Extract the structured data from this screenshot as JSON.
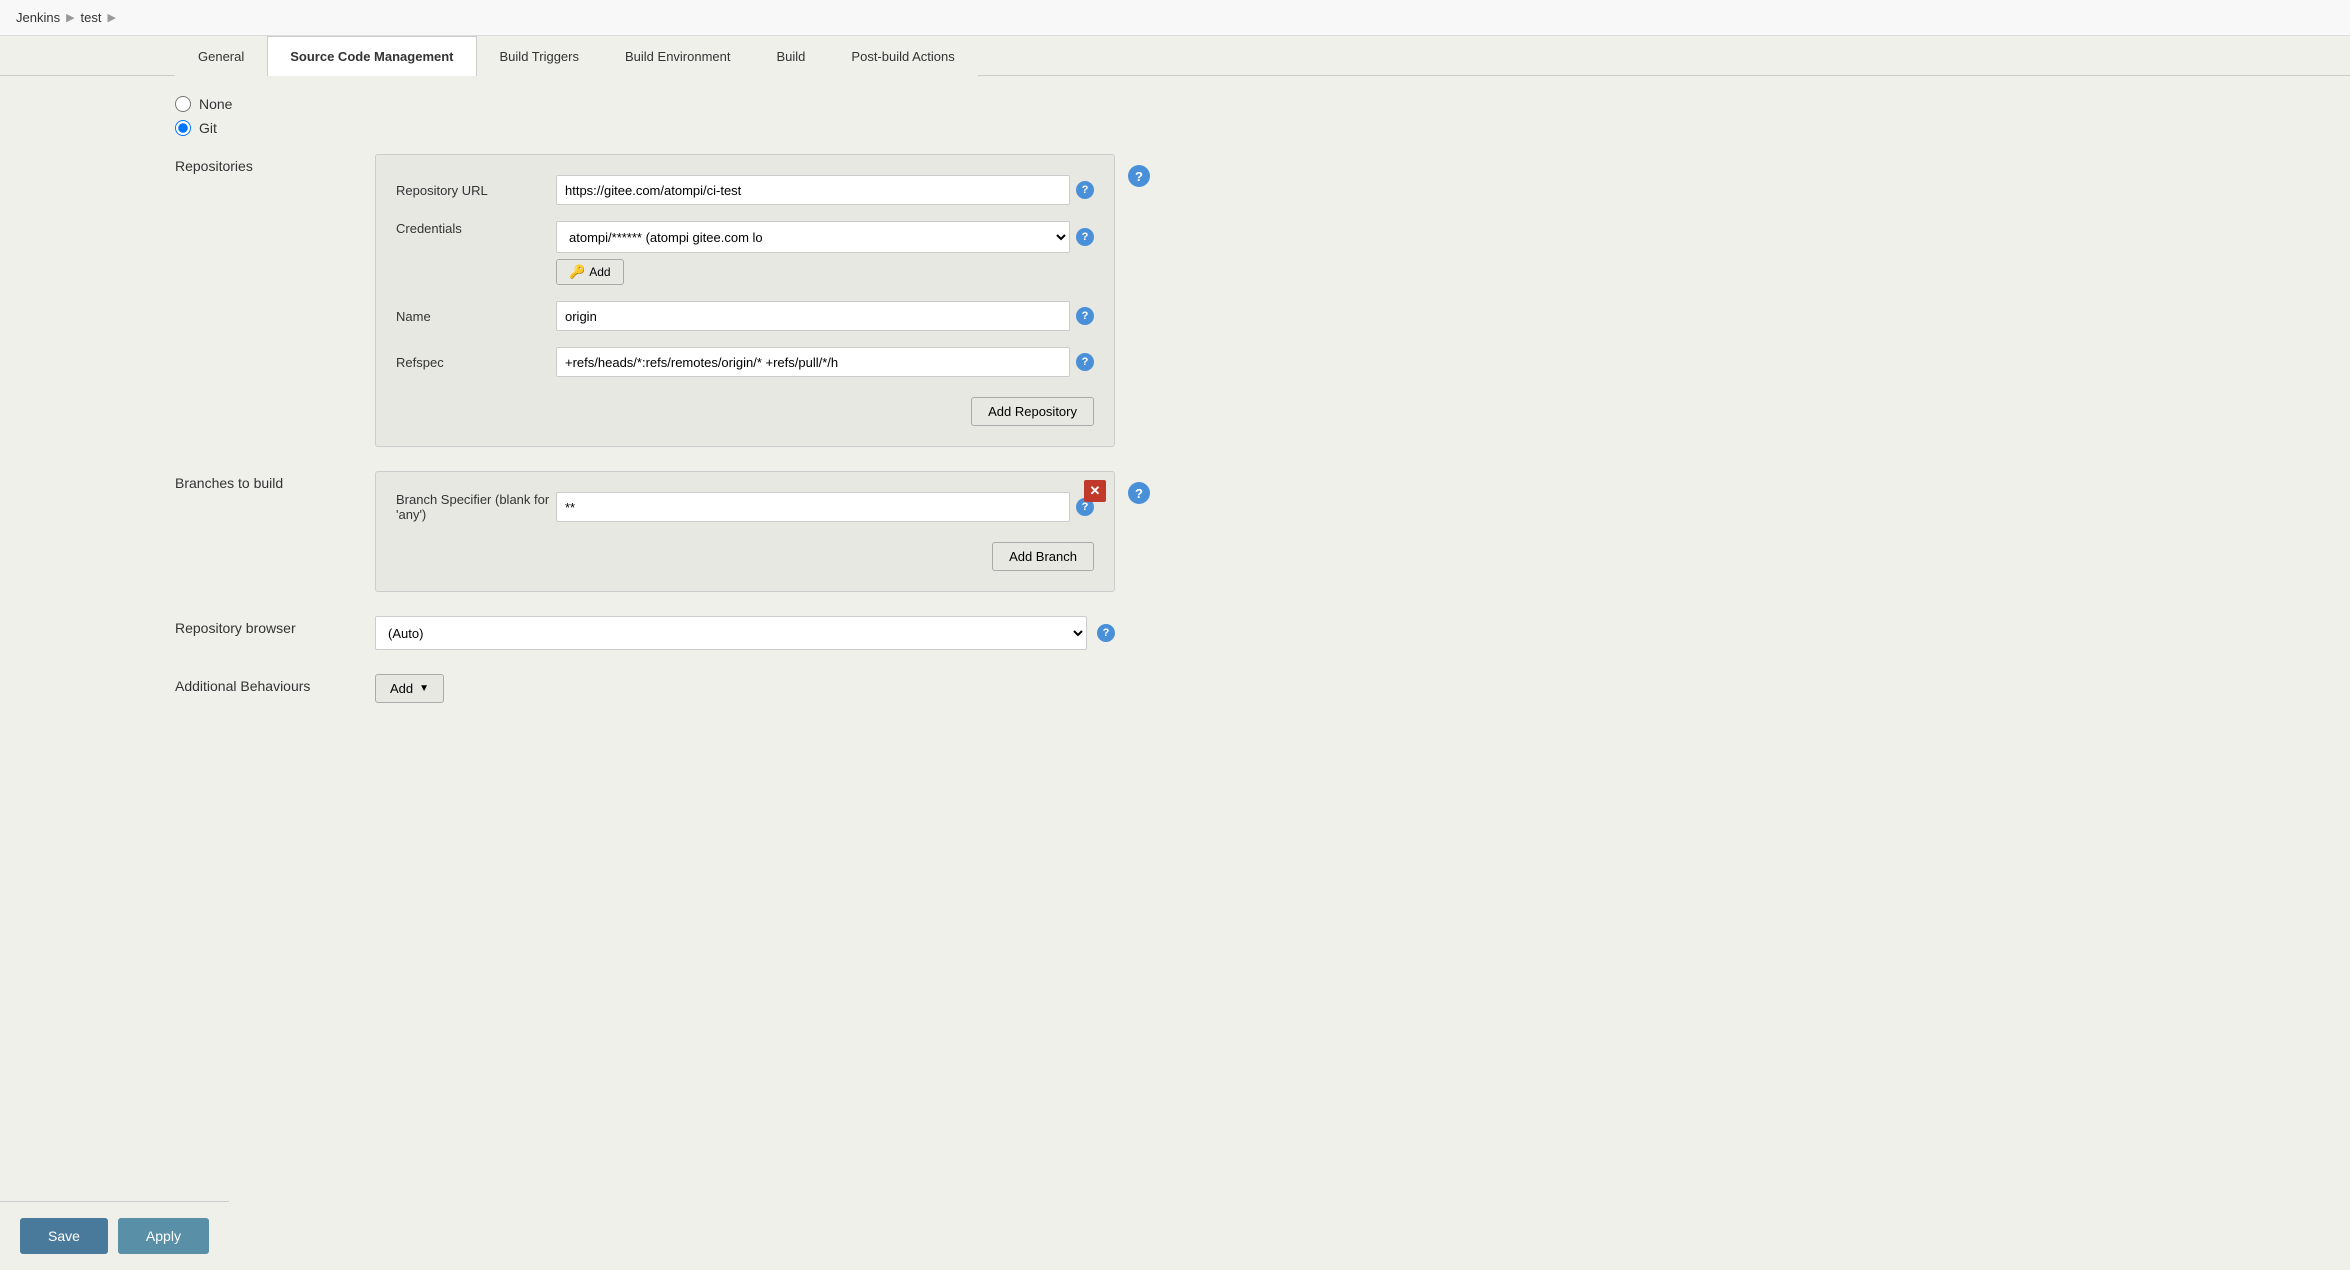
{
  "breadcrumb": {
    "items": [
      "Jenkins",
      "test"
    ],
    "separators": [
      "▶",
      "▶"
    ]
  },
  "tabs": [
    {
      "id": "general",
      "label": "General",
      "active": false
    },
    {
      "id": "source-code-management",
      "label": "Source Code Management",
      "active": true
    },
    {
      "id": "build-triggers",
      "label": "Build Triggers",
      "active": false
    },
    {
      "id": "build-environment",
      "label": "Build Environment",
      "active": false
    },
    {
      "id": "build",
      "label": "Build",
      "active": false
    },
    {
      "id": "post-build-actions",
      "label": "Post-build Actions",
      "active": false
    }
  ],
  "scm": {
    "options": [
      {
        "id": "none",
        "label": "None",
        "selected": false
      },
      {
        "id": "git",
        "label": "Git",
        "selected": true
      }
    ],
    "repositories_label": "Repositories",
    "repository_url_label": "Repository URL",
    "repository_url_value": "https://gitee.com/atompi/ci-test",
    "credentials_label": "Credentials",
    "credentials_value": "atompi/****** (atompi gitee.com lo",
    "name_label": "Name",
    "name_value": "origin",
    "refspec_label": "Refspec",
    "refspec_value": "+refs/heads/*:refs/remotes/origin/* +refs/pull/*/h",
    "add_repository_label": "Add Repository",
    "add_credentials_label": "Add",
    "branches_label": "Branches to build",
    "branch_specifier_label": "Branch Specifier (blank for 'any')",
    "branch_specifier_value": "**",
    "add_branch_label": "Add Branch",
    "repo_browser_label": "Repository browser",
    "repo_browser_value": "(Auto)",
    "additional_behaviours_label": "Additional Behaviours",
    "add_label": "Add"
  },
  "buttons": {
    "save_label": "Save",
    "apply_label": "Apply"
  }
}
